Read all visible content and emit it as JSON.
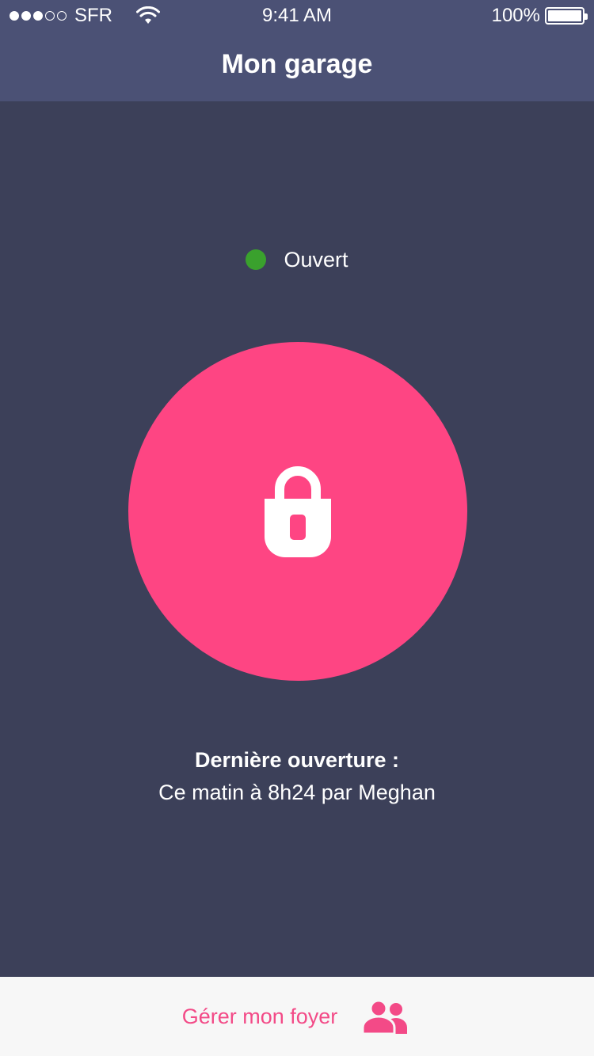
{
  "status_bar": {
    "carrier": "SFR",
    "time": "9:41 AM",
    "battery": "100%",
    "signal_bars": 3,
    "signal_total": 5
  },
  "header": {
    "title": "Mon garage"
  },
  "door": {
    "status_label": "Ouvert",
    "status_color": "#3aa12d",
    "lock_button_color": "#fe4583"
  },
  "last_opening": {
    "heading": "Dernière ouverture :",
    "detail": "Ce matin à 8h24 par Meghan"
  },
  "footer": {
    "label": "Gérer mon foyer",
    "icon": "people-icon",
    "accent": "#f34a87"
  },
  "colors": {
    "background": "#3c4059",
    "header": "#4b5175",
    "footer": "#f7f7f7"
  }
}
